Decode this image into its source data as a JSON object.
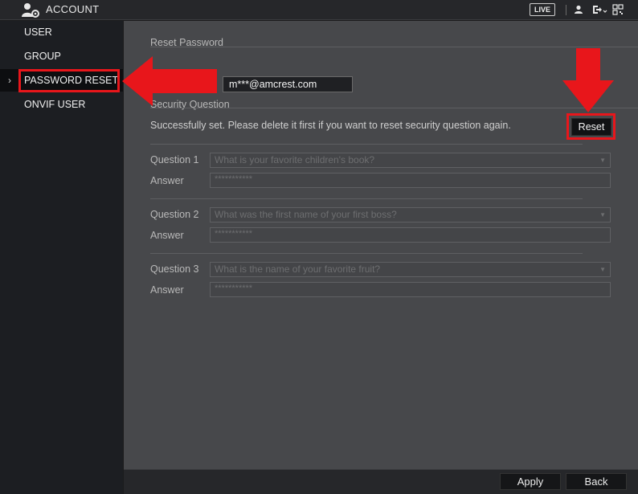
{
  "topbar": {
    "title": "ACCOUNT",
    "live_label": "LIVE",
    "icons": [
      "account-settings-icon",
      "user-icon",
      "logout-icon",
      "qr-code-icon"
    ]
  },
  "sidebar": {
    "items": [
      {
        "label": "USER"
      },
      {
        "label": "GROUP"
      },
      {
        "label": "PASSWORD RESET"
      },
      {
        "label": "ONVIF USER"
      }
    ],
    "active_index": 2
  },
  "main": {
    "reset_password_title": "Reset Password",
    "email_label": "Email Address",
    "email_label_visible": "ress",
    "email_value": "m***@amcrest.com",
    "security_question_title": "Security Question",
    "info_text": "Successfully set. Please delete it first if you want to reset security question again.",
    "reset_label": "Reset",
    "questions": [
      {
        "label": "Question 1",
        "value": "What is your favorite children's book?",
        "answer_label": "Answer",
        "answer_value": "***********"
      },
      {
        "label": "Question 2",
        "value": "What was the first name of your first boss?",
        "answer_label": "Answer",
        "answer_value": "***********"
      },
      {
        "label": "Question 3",
        "value": "What is the name of your favorite fruit?",
        "answer_label": "Answer",
        "answer_value": "***********"
      }
    ]
  },
  "footer": {
    "apply_label": "Apply",
    "back_label": "Back"
  },
  "colors": {
    "highlight": "#e8161b",
    "panel": "#47484b",
    "sidebar": "#1c1e22"
  }
}
